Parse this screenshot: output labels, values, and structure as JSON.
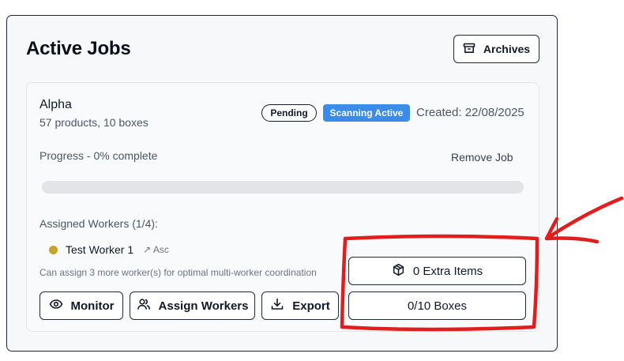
{
  "header": {
    "title": "Active Jobs",
    "archives_label": "Archives"
  },
  "job": {
    "name": "Alpha",
    "meta": "57 products, 10 boxes",
    "status_badge": "Pending",
    "scan_badge": "Scanning Active",
    "created": "Created: 22/08/2025",
    "progress_label": "Progress - 0% complete",
    "progress_fraction": 0,
    "remove_label": "Remove Job",
    "workers_label": "Assigned Workers (1/4):",
    "workers": [
      {
        "name": "Test Worker 1",
        "sort": "↗ Asc"
      }
    ],
    "hint": "Can assign 3 more worker(s) for optimal multi-worker coordination",
    "actions": {
      "monitor": "Monitor",
      "assign": "Assign Workers",
      "export": "Export",
      "extra_items": "0 Extra Items",
      "boxes": "0/10 Boxes"
    }
  },
  "colors": {
    "accent": "#3b8ce8",
    "worker_dot": "#c9a227",
    "annotation": "#e11d1d"
  },
  "icons": {
    "archives": "archive-box-icon",
    "monitor": "eye-icon",
    "assign": "users-icon",
    "export": "download-icon",
    "extra_items": "package-icon"
  }
}
